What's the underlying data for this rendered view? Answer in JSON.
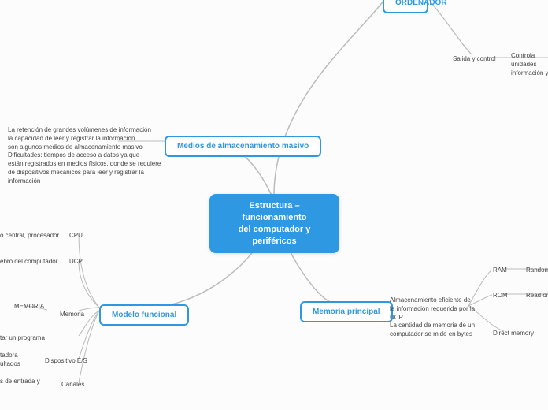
{
  "central": {
    "line1": "Estructura – funcionamiento",
    "line2": "del computador y periféricos"
  },
  "top_partial": "ORDENADOR",
  "salida": {
    "label": "Salida y control",
    "note": "Controla unidades\ninformación y la"
  },
  "medios": {
    "label": "Medios de almacenamiento masivo",
    "note": "La retención de grandes volúmenes de información\nla capacidad de leer y registrar la información\nson algunos medios de almacenamiento masivo\nDificultades: tiempos de acceso a datos ya que\nestán registrados en medios físicos, donde se requiere\nde dispositivos mecánicos para leer y registrar la información"
  },
  "modelo": {
    "label": "Modelo funcional",
    "cpu_line": "o central, procesador",
    "cpu": "CPU",
    "ucp_line": "ebro del computador",
    "ucp": "UCP",
    "memoria_title": "MEMORIA",
    "memoria": "Memoria",
    "programa": "tar un programa",
    "es_title": "tadora\nultados",
    "es": "Dispositivo E/S",
    "canales_line": "s de entrada y",
    "canales": "Canales"
  },
  "memoria_principal": {
    "label": "Memoria principal",
    "note": "Almacenamiento eficiente de\nla información requerida por la UCP\nLa cantidad de memoria de un\ncomputador se mide en bytes",
    "ram": "RAM",
    "ram_txt": "Random a",
    "rom": "ROM",
    "rom_txt": "Read onl",
    "dma": "Direct memory"
  }
}
